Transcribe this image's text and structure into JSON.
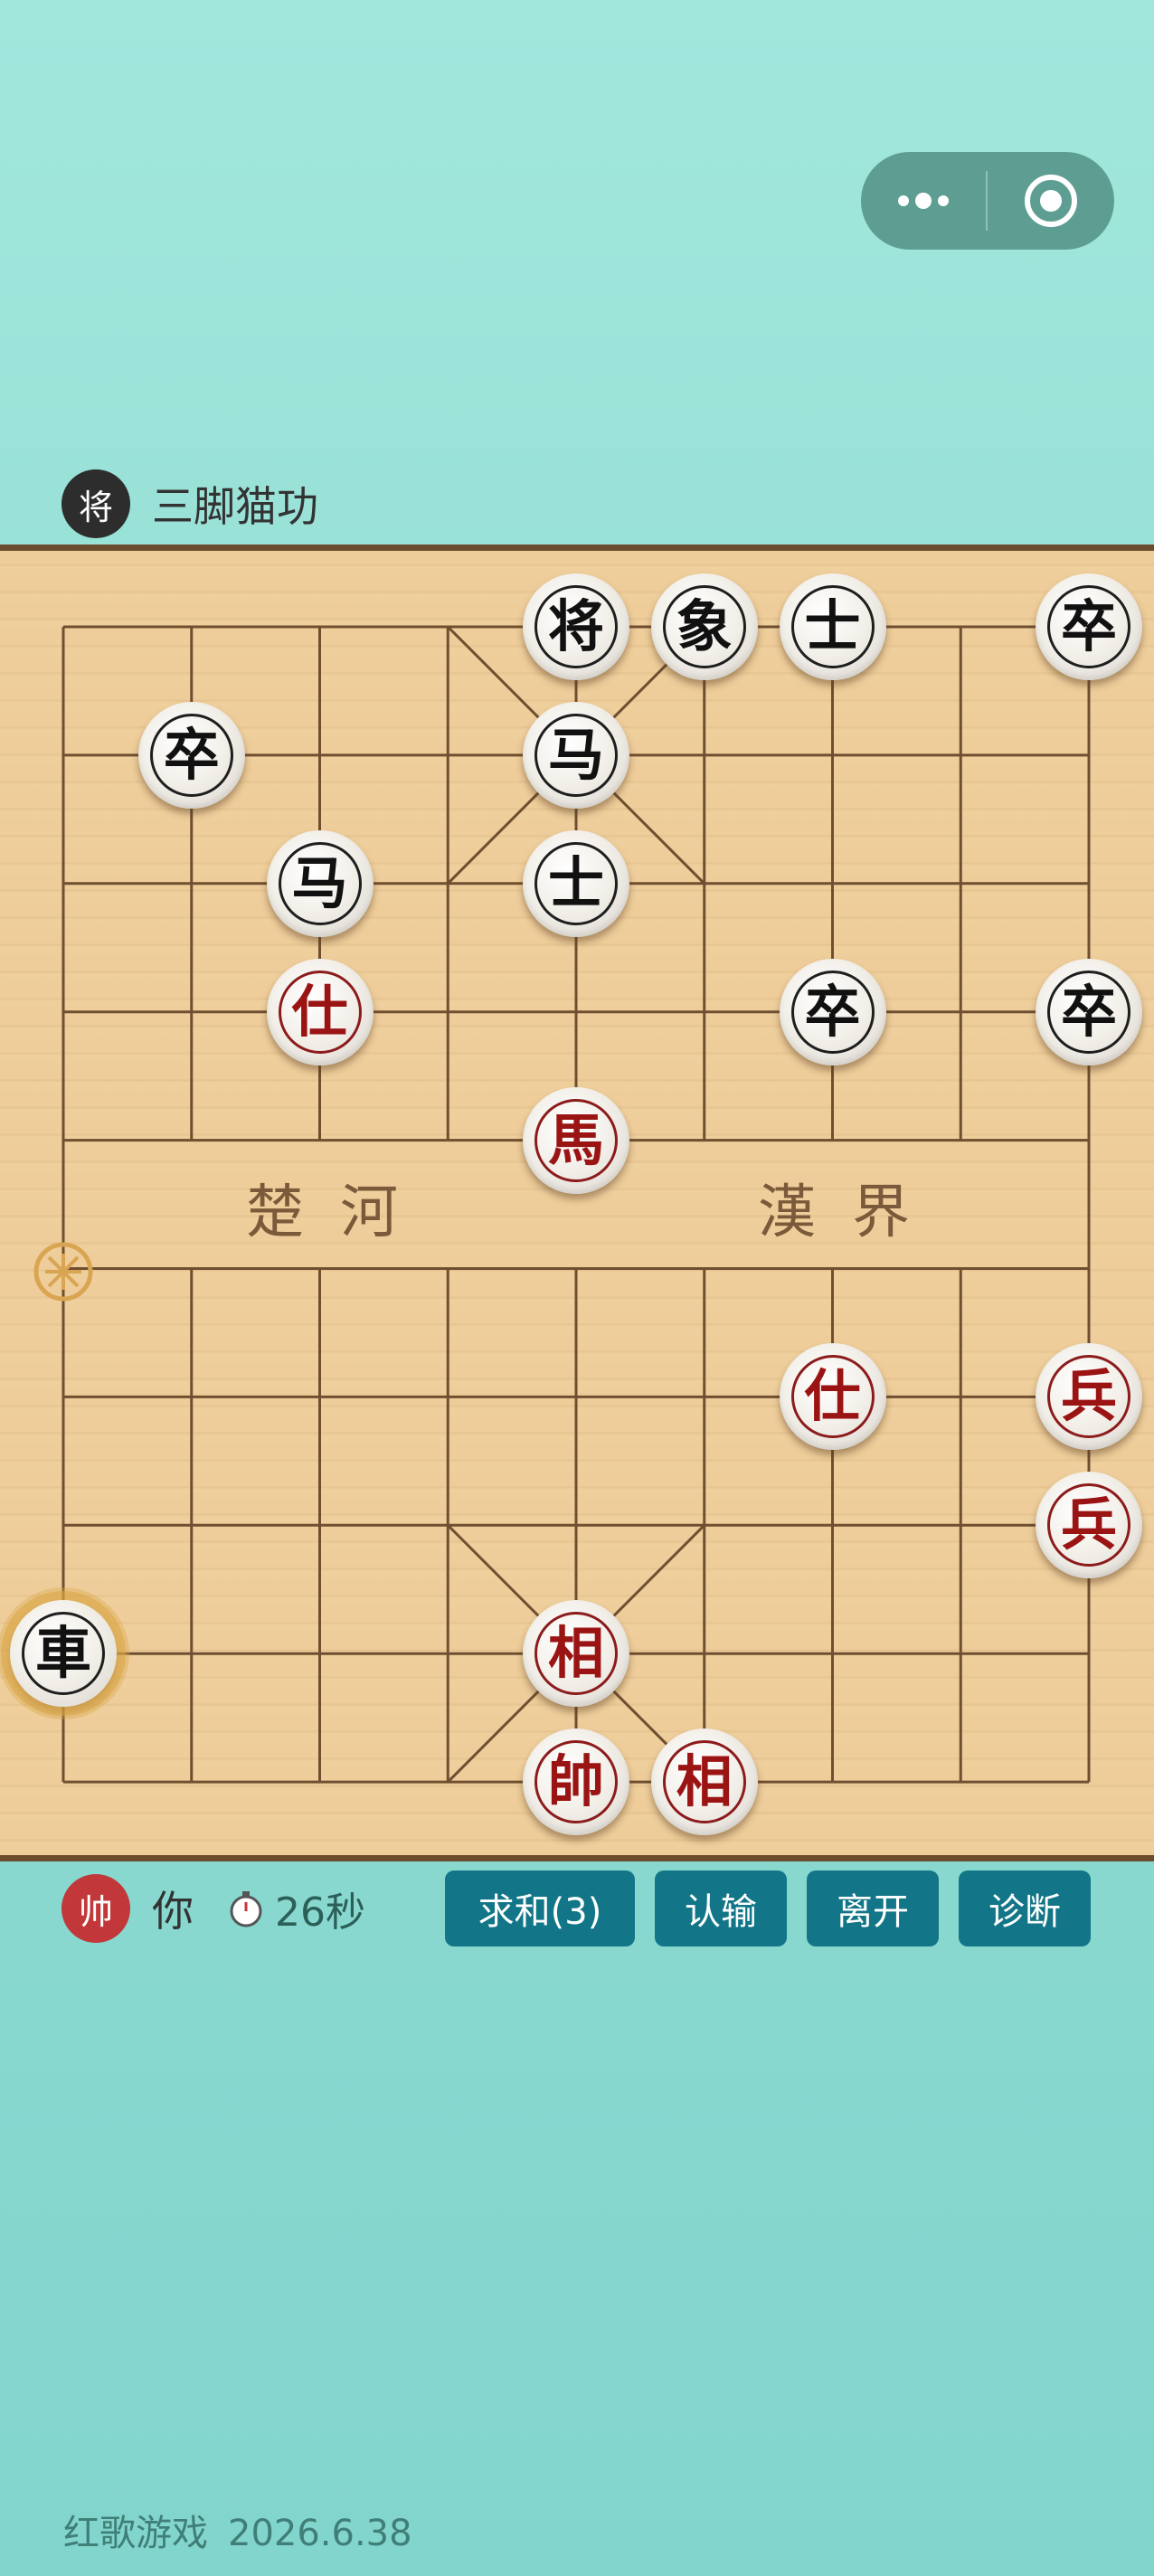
{
  "capsule": {
    "more_icon": "more-dots-icon",
    "close_icon": "target-icon"
  },
  "opponent": {
    "badge": "将",
    "name": "三脚猫功"
  },
  "player": {
    "badge": "帅",
    "name": "你",
    "timer_icon": "stopwatch-icon",
    "timer": "26秒"
  },
  "river": {
    "left": "楚河",
    "right": "漢界"
  },
  "actions": {
    "draw": "求和(3)",
    "resign": "认输",
    "leave": "离开",
    "diagnose": "诊断"
  },
  "footer": {
    "brand": "红歌游戏",
    "version": "2026.6.38"
  },
  "colors": {
    "red_piece": "#9b1414",
    "black_piece": "#111111",
    "button": "#127688",
    "board": "#eecd9a"
  },
  "pieces": [
    {
      "side": "black",
      "label": "将",
      "col": 4,
      "row": 0
    },
    {
      "side": "black",
      "label": "象",
      "col": 5,
      "row": 0
    },
    {
      "side": "black",
      "label": "士",
      "col": 6,
      "row": 0
    },
    {
      "side": "black",
      "label": "卒",
      "col": 8,
      "row": 0
    },
    {
      "side": "black",
      "label": "卒",
      "col": 1,
      "row": 1
    },
    {
      "side": "black",
      "label": "马",
      "col": 4,
      "row": 1
    },
    {
      "side": "black",
      "label": "马",
      "col": 2,
      "row": 2
    },
    {
      "side": "black",
      "label": "士",
      "col": 4,
      "row": 2
    },
    {
      "side": "red",
      "label": "仕",
      "col": 2,
      "row": 3
    },
    {
      "side": "black",
      "label": "卒",
      "col": 6,
      "row": 3
    },
    {
      "side": "black",
      "label": "卒",
      "col": 8,
      "row": 3
    },
    {
      "side": "red",
      "label": "馬",
      "col": 4,
      "row": 4
    },
    {
      "side": "red",
      "label": "仕",
      "col": 6,
      "row": 6
    },
    {
      "side": "red",
      "label": "兵",
      "col": 8,
      "row": 6
    },
    {
      "side": "red",
      "label": "兵",
      "col": 8,
      "row": 7
    },
    {
      "side": "black",
      "label": "車",
      "col": 0,
      "row": 8,
      "selected": true
    },
    {
      "side": "red",
      "label": "相",
      "col": 4,
      "row": 8
    },
    {
      "side": "red",
      "label": "帥",
      "col": 4,
      "row": 9
    },
    {
      "side": "red",
      "label": "相",
      "col": 5,
      "row": 9
    }
  ]
}
